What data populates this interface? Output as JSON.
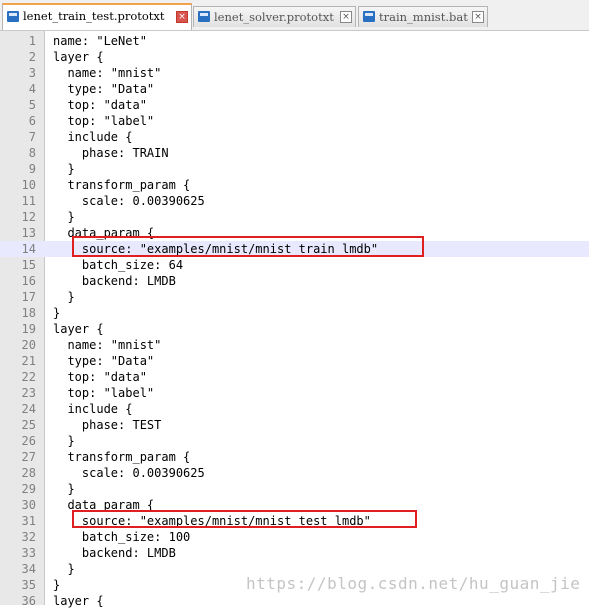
{
  "tabs": [
    {
      "label": "lenet_train_test.prototxt",
      "active": true
    },
    {
      "label": "lenet_solver.prototxt",
      "active": false
    },
    {
      "label": "train_mnist.bat",
      "active": false
    }
  ],
  "editor": {
    "current_line": 14,
    "lines": [
      {
        "n": "1",
        "text": "name: \"LeNet\""
      },
      {
        "n": "2",
        "text": "layer {"
      },
      {
        "n": "3",
        "text": "  name: \"mnist\""
      },
      {
        "n": "4",
        "text": "  type: \"Data\""
      },
      {
        "n": "5",
        "text": "  top: \"data\""
      },
      {
        "n": "6",
        "text": "  top: \"label\""
      },
      {
        "n": "7",
        "text": "  include {"
      },
      {
        "n": "8",
        "text": "    phase: TRAIN"
      },
      {
        "n": "9",
        "text": "  }"
      },
      {
        "n": "10",
        "text": "  transform_param {"
      },
      {
        "n": "11",
        "text": "    scale: 0.00390625"
      },
      {
        "n": "12",
        "text": "  }"
      },
      {
        "n": "13",
        "text": "  data_param {"
      },
      {
        "n": "14",
        "text": "    source: \"examples/mnist/mnist_train_lmdb\""
      },
      {
        "n": "15",
        "text": "    batch_size: 64"
      },
      {
        "n": "16",
        "text": "    backend: LMDB"
      },
      {
        "n": "17",
        "text": "  }"
      },
      {
        "n": "18",
        "text": "}"
      },
      {
        "n": "19",
        "text": "layer {"
      },
      {
        "n": "20",
        "text": "  name: \"mnist\""
      },
      {
        "n": "21",
        "text": "  type: \"Data\""
      },
      {
        "n": "22",
        "text": "  top: \"data\""
      },
      {
        "n": "23",
        "text": "  top: \"label\""
      },
      {
        "n": "24",
        "text": "  include {"
      },
      {
        "n": "25",
        "text": "    phase: TEST"
      },
      {
        "n": "26",
        "text": "  }"
      },
      {
        "n": "27",
        "text": "  transform_param {"
      },
      {
        "n": "28",
        "text": "    scale: 0.00390625"
      },
      {
        "n": "29",
        "text": "  }"
      },
      {
        "n": "30",
        "text": "  data_param {"
      },
      {
        "n": "31",
        "text": "    source: \"examples/mnist/mnist_test_lmdb\""
      },
      {
        "n": "32",
        "text": "    batch_size: 100"
      },
      {
        "n": "33",
        "text": "    backend: LMDB"
      },
      {
        "n": "34",
        "text": "  }"
      },
      {
        "n": "35",
        "text": "}"
      },
      {
        "n": "36",
        "text": "layer {"
      }
    ]
  },
  "watermark": "https://blog.csdn.net/hu_guan_jie",
  "colors": {
    "highlight_box": "#e02020",
    "current_line": "#e8e8ff",
    "active_tab_accent": "#f2a24b"
  }
}
